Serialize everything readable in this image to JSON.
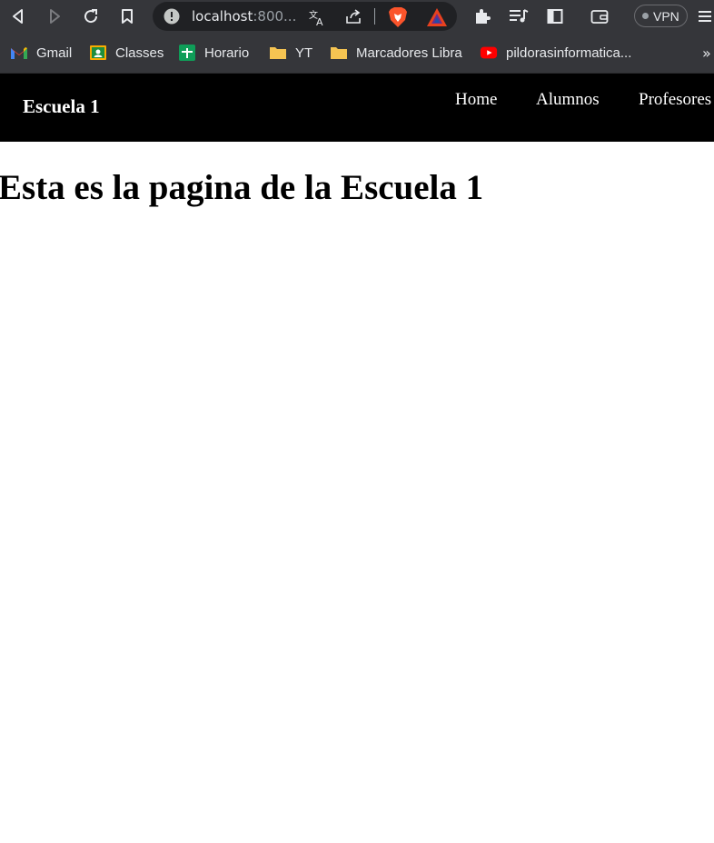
{
  "browser": {
    "address": {
      "host": "localhost",
      "port_truncated": ":800..."
    },
    "vpn_label": "VPN",
    "bookmarks": [
      {
        "label": "Gmail",
        "icon": "gmail-icon"
      },
      {
        "label": "Classes",
        "icon": "google-classroom-icon"
      },
      {
        "label": "Horario",
        "icon": "google-sheets-icon"
      },
      {
        "label": "YT",
        "icon": "folder-icon"
      },
      {
        "label": "Marcadores Libra",
        "icon": "folder-icon"
      },
      {
        "label": "pildorasinformatica...",
        "icon": "youtube-icon"
      }
    ],
    "bookmarks_overflow": "»"
  },
  "site": {
    "brand": "Escuela 1",
    "nav": [
      "Home",
      "Alumnos",
      "Profesores"
    ],
    "heading": "Esta es la pagina de la Escuela 1"
  },
  "colors": {
    "chrome_bg": "#35363a",
    "address_bg": "#202124",
    "nav_bg": "#000000",
    "nav_text": "#ffffff",
    "brave_orange": "#fb542b",
    "youtube_red": "#ff0000"
  }
}
